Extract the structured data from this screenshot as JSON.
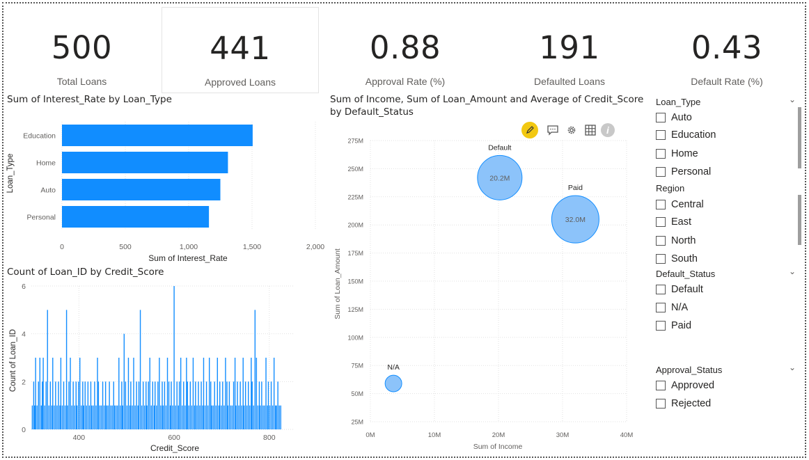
{
  "kpis": [
    {
      "value": "500",
      "label": "Total Loans"
    },
    {
      "value": "441",
      "label": "Approved Loans"
    },
    {
      "value": "0.88",
      "label": "Approval Rate (%)"
    },
    {
      "value": "191",
      "label": "Defaulted Loans"
    },
    {
      "value": "0.43",
      "label": "Default Rate (%)"
    }
  ],
  "visual_toolbar": {
    "icons": [
      "pencil-icon",
      "comment-icon",
      "gear-icon",
      "table-icon",
      "info-icon"
    ],
    "accent": "#f2c811"
  },
  "slicers": {
    "loan_type": {
      "title": "Loan_Type",
      "options": [
        "Auto",
        "Education",
        "Home",
        "Personal"
      ]
    },
    "region": {
      "title": "Region",
      "options": [
        "Central",
        "East",
        "North",
        "South"
      ]
    },
    "default_status": {
      "title": "Default_Status",
      "options": [
        "Default",
        "N/A",
        "Paid"
      ]
    },
    "approval_status": {
      "title": "Approval_Status",
      "options": [
        "Approved",
        "Rejected"
      ]
    }
  },
  "chart_data": [
    {
      "type": "bar",
      "orientation": "horizontal",
      "title": "Sum of Interest_Rate by Loan_Type",
      "xlabel": "Sum of Interest_Rate",
      "ylabel": "Loan_Type",
      "categories": [
        "Education",
        "Home",
        "Auto",
        "Personal"
      ],
      "values": [
        1505,
        1310,
        1250,
        1160
      ],
      "xlim": [
        0,
        2000
      ],
      "xticks": [
        "0",
        "500",
        "1,000",
        "1,500",
        "2,000"
      ],
      "color": "#118dff",
      "grid": true
    },
    {
      "type": "bar",
      "title": "Count of Loan_ID by Credit_Score",
      "xlabel": "Credit_Score",
      "ylabel": "Count of Loan_ID",
      "xlim": [
        300,
        850
      ],
      "ylim": [
        0,
        6
      ],
      "xticks": [
        "400",
        "600",
        "800"
      ],
      "yticks": [
        "0",
        "2",
        "4",
        "6"
      ],
      "color": "#118dff",
      "grid": true,
      "x": [
        302,
        305,
        307,
        309,
        312,
        315,
        318,
        321,
        323,
        325,
        328,
        331,
        334,
        337,
        340,
        343,
        345,
        348,
        351,
        354,
        357,
        360,
        362,
        365,
        368,
        371,
        374,
        376,
        379,
        382,
        385,
        388,
        391,
        394,
        396,
        399,
        402,
        405,
        408,
        410,
        413,
        416,
        419,
        422,
        425,
        427,
        430,
        433,
        436,
        439,
        441,
        444,
        447,
        450,
        453,
        456,
        458,
        461,
        464,
        467,
        470,
        473,
        475,
        478,
        481,
        484,
        487,
        490,
        492,
        495,
        498,
        501,
        504,
        507,
        509,
        512,
        515,
        518,
        521,
        524,
        526,
        529,
        532,
        535,
        538,
        541,
        543,
        546,
        549,
        552,
        555,
        558,
        560,
        563,
        566,
        569,
        572,
        575,
        577,
        580,
        583,
        586,
        589,
        592,
        594,
        597,
        600,
        603,
        606,
        609,
        611,
        614,
        617,
        620,
        623,
        626,
        628,
        631,
        634,
        637,
        640,
        643,
        645,
        648,
        651,
        654,
        657,
        660,
        662,
        665,
        668,
        671,
        674,
        677,
        679,
        682,
        685,
        688,
        691,
        694,
        696,
        699,
        702,
        705,
        708,
        711,
        713,
        716,
        719,
        722,
        725,
        728,
        730,
        733,
        736,
        739,
        742,
        745,
        747,
        750,
        753,
        756,
        759,
        762,
        764,
        767,
        770,
        773,
        776,
        779,
        781,
        784,
        787,
        790,
        793,
        796,
        798,
        801,
        804,
        807,
        810,
        813,
        815,
        818,
        821,
        824,
        827,
        830,
        832,
        835,
        838,
        841,
        844,
        847
      ],
      "values": [
        1,
        2,
        1,
        3,
        1,
        2,
        3,
        1,
        2,
        3,
        1,
        2,
        5,
        1,
        2,
        1,
        3,
        1,
        2,
        1,
        2,
        1,
        3,
        1,
        2,
        1,
        5,
        1,
        2,
        3,
        1,
        2,
        1,
        2,
        1,
        2,
        3,
        1,
        2,
        1,
        2,
        1,
        2,
        1,
        2,
        1,
        1,
        2,
        1,
        3,
        2,
        1,
        1,
        2,
        1,
        2,
        1,
        1,
        2,
        1,
        1,
        2,
        1,
        1,
        1,
        3,
        1,
        2,
        1,
        4,
        2,
        1,
        3,
        1,
        2,
        1,
        3,
        1,
        2,
        1,
        2,
        5,
        1,
        2,
        1,
        2,
        1,
        2,
        3,
        1,
        2,
        1,
        2,
        1,
        2,
        3,
        1,
        2,
        1,
        2,
        1,
        3,
        2,
        1,
        2,
        1,
        6,
        1,
        2,
        1,
        2,
        3,
        1,
        2,
        1,
        3,
        2,
        1,
        2,
        1,
        3,
        1,
        2,
        1,
        2,
        1,
        2,
        1,
        3,
        1,
        2,
        1,
        3,
        2,
        1,
        1,
        2,
        1,
        3,
        1,
        2,
        1,
        2,
        1,
        3,
        2,
        1,
        2,
        1,
        1,
        2,
        3,
        1,
        2,
        1,
        2,
        1,
        3,
        1,
        2,
        1,
        2,
        1,
        3,
        2,
        1,
        5,
        3,
        1,
        2,
        1,
        2,
        1,
        1,
        3,
        1,
        2,
        1,
        2,
        1,
        3,
        1,
        1,
        2,
        1,
        1
      ]
    },
    {
      "type": "scatter",
      "subtype": "bubble",
      "title": "Sum of Income, Sum of Loan_Amount and Average of Credit_Score by Default_Status",
      "xlabel": "Sum of Income",
      "ylabel": "Sum of Loan_Amount",
      "xlim": [
        0,
        40000000
      ],
      "ylim": [
        25000000,
        275000000
      ],
      "xticks": [
        "0M",
        "10M",
        "20M",
        "30M",
        "40M"
      ],
      "yticks": [
        "25M",
        "50M",
        "75M",
        "100M",
        "125M",
        "150M",
        "175M",
        "200M",
        "225M",
        "250M",
        "275M"
      ],
      "color": "#118dff",
      "grid": true,
      "points": [
        {
          "name": "Default",
          "x": 20200000,
          "y": 242000000,
          "label": "20.2M",
          "size": 1
        },
        {
          "name": "Paid",
          "x": 32000000,
          "y": 205000000,
          "label": "32.0M",
          "size": 1.13
        },
        {
          "name": "N/A",
          "x": 3600000,
          "y": 59000000,
          "label": "",
          "size": 0.14
        }
      ]
    }
  ]
}
